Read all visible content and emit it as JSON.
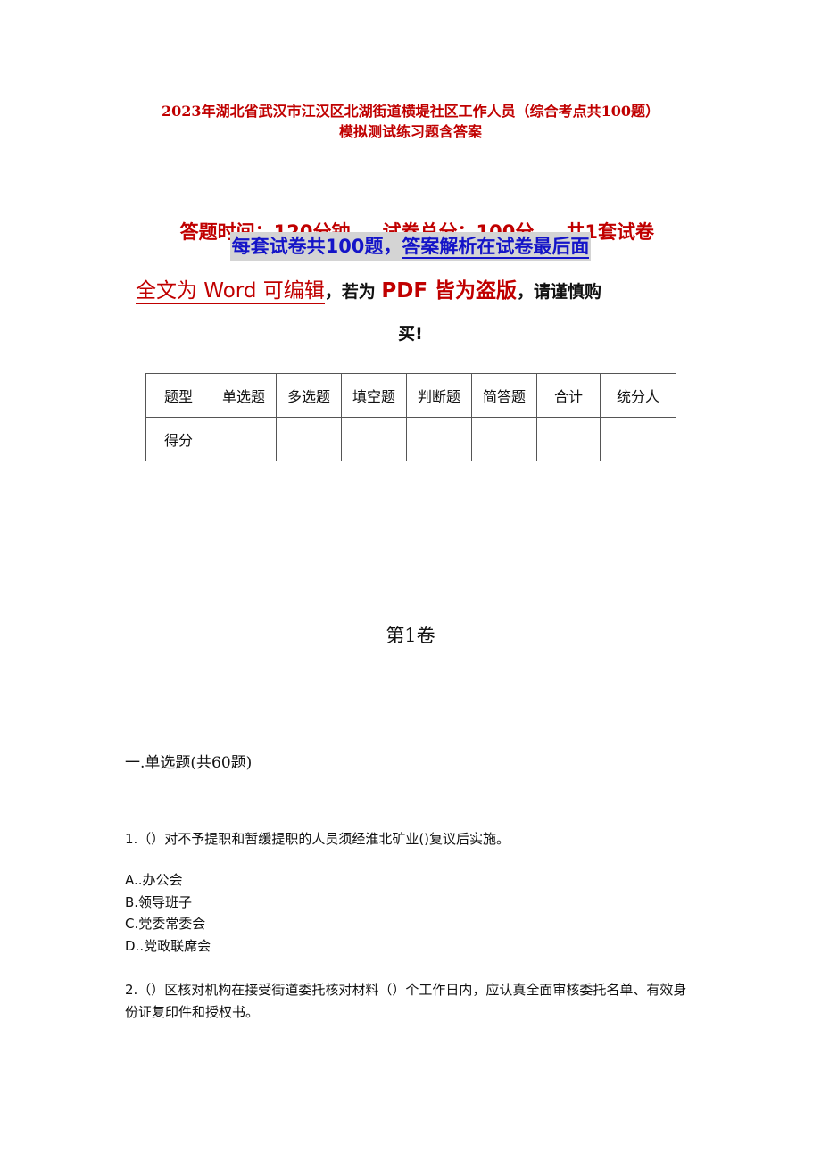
{
  "document": {
    "title_line1": "2023年湖北省武汉市江汉区北湖街道横堤社区工作人员（综合考点共100题）",
    "title_line2": "模拟测试练习题含答案",
    "info": {
      "time": "答题时间：120分钟",
      "total_score": "试卷总分：100分",
      "sets": "共1套试卷"
    },
    "notice": {
      "part1": "每套试卷共100题，",
      "part2": "答案解析在试卷最后面"
    },
    "editable": {
      "part1": "全文为 Word 可编辑",
      "comma1": "，若为 ",
      "part2": "PDF 皆为盗版",
      "part3": "，请谨慎购",
      "part4": "买!"
    },
    "score_table": {
      "header": [
        "题型",
        "单选题",
        "多选题",
        "填空题",
        "判断题",
        "简答题",
        "合计",
        "统分人"
      ],
      "row": [
        "得分",
        "",
        "",
        "",
        "",
        "",
        "",
        ""
      ]
    },
    "volume_heading": "第1卷",
    "section_heading": "一.单选题(共60题)",
    "questions": [
      {
        "text": "1.（）对不予提职和暂缓提职的人员须经淮北矿业()复议后实施。",
        "options": [
          "A..办公会",
          "B.领导班子",
          "C.党委常委会",
          "D..党政联席会"
        ]
      },
      {
        "text": "2.（）区核对机构在接受街道委托核对材料（）个工作日内，应认真全面审核委托名单、有效身份证复印件和授权书。",
        "options": []
      }
    ]
  },
  "colors": {
    "title_red": "#c00000",
    "notice_blue": "#1414c8",
    "notice_highlight": "#d4d4d4",
    "text": "#111111",
    "table_border": "#555555"
  }
}
